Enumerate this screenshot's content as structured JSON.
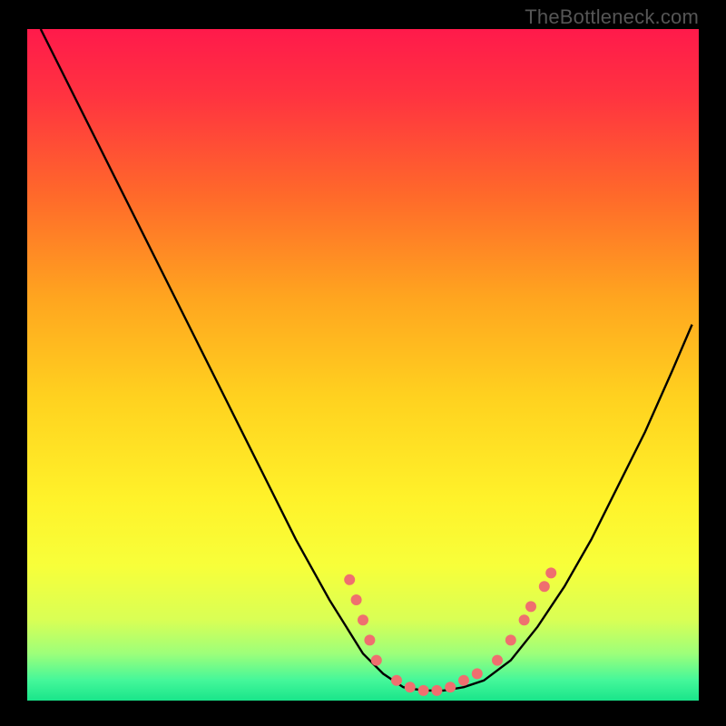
{
  "watermark": "TheBottleneck.com",
  "chart_data": {
    "type": "line",
    "title": "",
    "xlabel": "",
    "ylabel": "",
    "xlim": [
      0,
      100
    ],
    "ylim": [
      0,
      100
    ],
    "grid": false,
    "legend": false,
    "background_gradient": {
      "stops": [
        {
          "offset": 0.0,
          "color": "#ff1a4b"
        },
        {
          "offset": 0.1,
          "color": "#ff3340"
        },
        {
          "offset": 0.25,
          "color": "#ff6a2a"
        },
        {
          "offset": 0.4,
          "color": "#ffa51f"
        },
        {
          "offset": 0.55,
          "color": "#ffd21f"
        },
        {
          "offset": 0.7,
          "color": "#fff22a"
        },
        {
          "offset": 0.8,
          "color": "#f7ff3a"
        },
        {
          "offset": 0.88,
          "color": "#d9ff55"
        },
        {
          "offset": 0.93,
          "color": "#9dff7a"
        },
        {
          "offset": 0.97,
          "color": "#44f79a"
        },
        {
          "offset": 1.0,
          "color": "#19e58a"
        }
      ]
    },
    "series": [
      {
        "name": "bottleneck-curve",
        "color": "#000000",
        "x": [
          2,
          5,
          10,
          15,
          20,
          25,
          30,
          35,
          40,
          45,
          50,
          53,
          56,
          59,
          62,
          65,
          68,
          72,
          76,
          80,
          84,
          88,
          92,
          96,
          99
        ],
        "y": [
          100,
          94,
          84,
          74,
          64,
          54,
          44,
          34,
          24,
          15,
          7,
          4,
          2,
          1.5,
          1.5,
          2,
          3,
          6,
          11,
          17,
          24,
          32,
          40,
          49,
          56
        ]
      }
    ],
    "markers": {
      "name": "highlight-dots",
      "color": "#ef6f6f",
      "radius": 6,
      "points": [
        {
          "x": 48,
          "y": 18
        },
        {
          "x": 49,
          "y": 15
        },
        {
          "x": 50,
          "y": 12
        },
        {
          "x": 51,
          "y": 9
        },
        {
          "x": 52,
          "y": 6
        },
        {
          "x": 55,
          "y": 3
        },
        {
          "x": 57,
          "y": 2
        },
        {
          "x": 59,
          "y": 1.5
        },
        {
          "x": 61,
          "y": 1.5
        },
        {
          "x": 63,
          "y": 2
        },
        {
          "x": 65,
          "y": 3
        },
        {
          "x": 67,
          "y": 4
        },
        {
          "x": 70,
          "y": 6
        },
        {
          "x": 72,
          "y": 9
        },
        {
          "x": 74,
          "y": 12
        },
        {
          "x": 75,
          "y": 14
        },
        {
          "x": 77,
          "y": 17
        },
        {
          "x": 78,
          "y": 19
        }
      ]
    }
  }
}
